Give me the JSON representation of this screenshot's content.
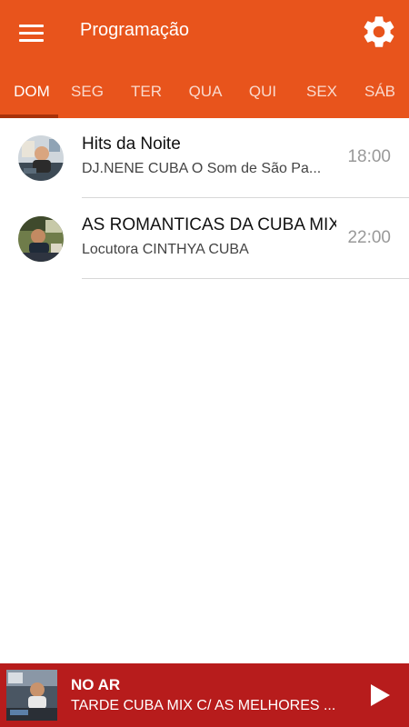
{
  "header": {
    "title": "Programação",
    "menu_icon": "hamburger-menu-icon",
    "settings_icon": "gear-icon",
    "background": "#e8541c"
  },
  "tabs": [
    {
      "label": "DOM",
      "active": true
    },
    {
      "label": "SEG",
      "active": false
    },
    {
      "label": "TER",
      "active": false
    },
    {
      "label": "QUA",
      "active": false
    },
    {
      "label": "QUI",
      "active": false
    },
    {
      "label": "SEX",
      "active": false
    },
    {
      "label": "SÁB",
      "active": false
    }
  ],
  "schedule": [
    {
      "title": "Hits da Noite",
      "host": "DJ.NENE CUBA O Som de São Pa...",
      "time": "18:00"
    },
    {
      "title": "AS ROMANTICAS DA CUBA MIX",
      "host": "Locutora CINTHYA CUBA",
      "time": "22:00"
    }
  ],
  "player": {
    "status": "NO AR",
    "now_playing": "TARDE CUBA MIX C/ AS MELHORES ...",
    "play_icon": "play-icon",
    "background": "#b71c1c"
  }
}
